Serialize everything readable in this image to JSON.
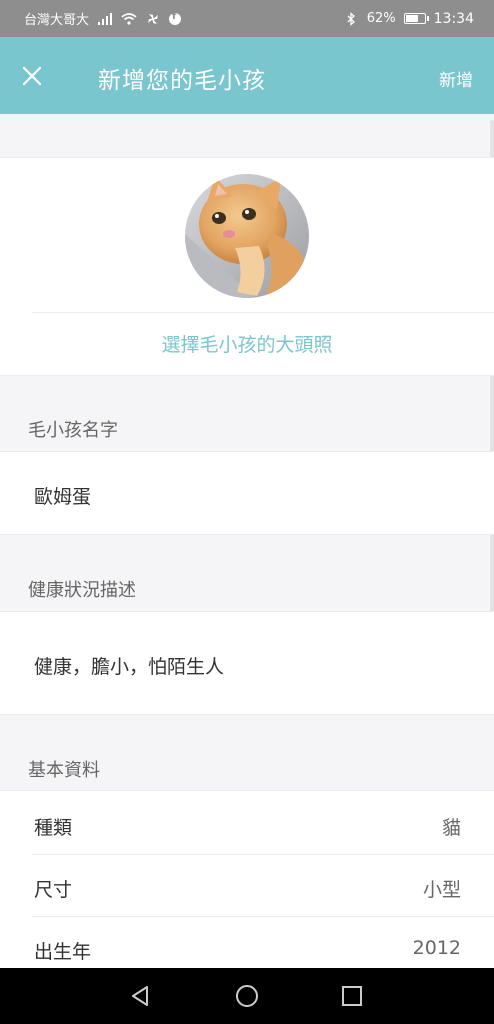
{
  "status_bar": {
    "carrier": "台灣大哥大",
    "battery": "62%",
    "time": "13:34",
    "icons": [
      "signal-icon",
      "wifi-icon",
      "pinwheel-icon",
      "facebook-icon",
      "bluetooth-icon",
      "battery-icon"
    ]
  },
  "app_bar": {
    "close_icon": "close-icon",
    "title": "新增您的毛小孩",
    "add_label": "新增",
    "background": "#7ac6cf"
  },
  "avatar": {
    "link_text": "選擇毛小孩的大頭照"
  },
  "name_section": {
    "label": "毛小孩名字",
    "value": "歐姆蛋"
  },
  "health_section": {
    "label": "健康狀況描述",
    "value": "健康，膽小，怕陌生人"
  },
  "basic_info": {
    "label": "基本資料",
    "rows": [
      {
        "key": "種類",
        "value": "貓"
      },
      {
        "key": "尺寸",
        "value": "小型"
      },
      {
        "key": "出生年",
        "value": "2012"
      }
    ]
  },
  "nav_bar": {
    "icons": [
      "back-icon",
      "home-icon",
      "recents-icon"
    ]
  }
}
